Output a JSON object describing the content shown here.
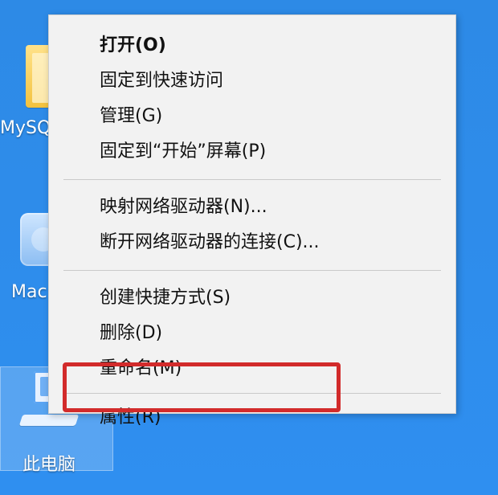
{
  "desktop": {
    "icons": [
      {
        "name": "folder-mysql",
        "label": "MySQ"
      },
      {
        "name": "mac-icon",
        "label": "Mac"
      },
      {
        "name": "this-pc",
        "label": "此电脑"
      }
    ]
  },
  "context_menu": {
    "groups": [
      [
        {
          "label": "打开(O)",
          "bold": true
        },
        {
          "label": "固定到快速访问"
        },
        {
          "label": "管理(G)"
        },
        {
          "label": "固定到“开始”屏幕(P)"
        }
      ],
      [
        {
          "label": "映射网络驱动器(N)..."
        },
        {
          "label": "断开网络驱动器的连接(C)..."
        }
      ],
      [
        {
          "label": "创建快捷方式(S)"
        },
        {
          "label": "删除(D)"
        },
        {
          "label": "重命名(M)"
        }
      ],
      [
        {
          "label": "属性(R)"
        }
      ]
    ]
  },
  "annotation": {
    "highlight_color": "#d22b2b"
  }
}
